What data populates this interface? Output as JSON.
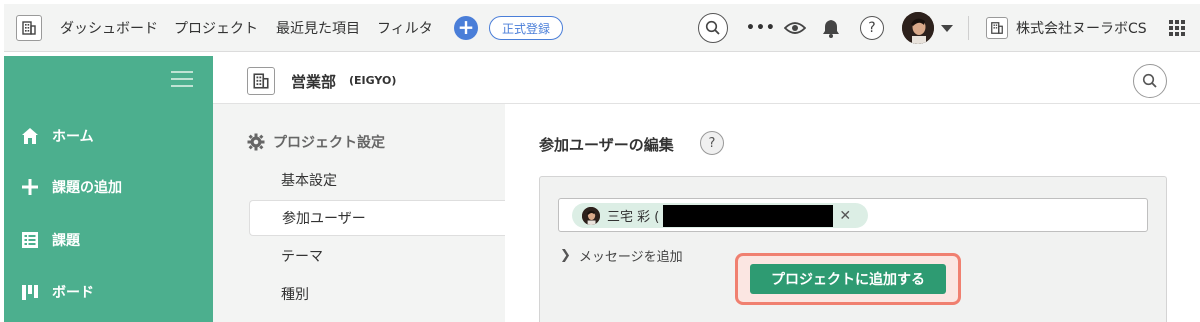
{
  "topbar": {
    "nav": [
      "ダッシュボード",
      "プロジェクト",
      "最近見た項目",
      "フィルタ"
    ],
    "register_badge": "正式登録",
    "more": "•••",
    "org_name": "株式会社ヌーラボCS"
  },
  "sidebar": {
    "items": [
      {
        "label": "ホーム",
        "icon": "home-icon"
      },
      {
        "label": "課題の追加",
        "icon": "plus-icon"
      },
      {
        "label": "課題",
        "icon": "list-icon"
      },
      {
        "label": "ボード",
        "icon": "board-icon"
      }
    ]
  },
  "project": {
    "name": "営業部",
    "key": "(EIGYO)"
  },
  "settings_nav": {
    "heading": "プロジェクト設定",
    "items": [
      {
        "label": "基本設定",
        "active": false
      },
      {
        "label": "参加ユーザー",
        "active": true
      },
      {
        "label": "テーマ",
        "active": false
      },
      {
        "label": "種別",
        "active": false
      }
    ]
  },
  "main": {
    "title": "参加ユーザーの編集",
    "help": "?",
    "chip_name": "三宅 彩 (",
    "chip_remove": "✕",
    "add_message": "メッセージを追加",
    "submit_label": "プロジェクトに追加する"
  },
  "colors": {
    "sidebar": "#4caf8e",
    "primary_button": "#2e9b72",
    "accent_blue": "#4a7ed8",
    "highlight": "#f08070"
  }
}
